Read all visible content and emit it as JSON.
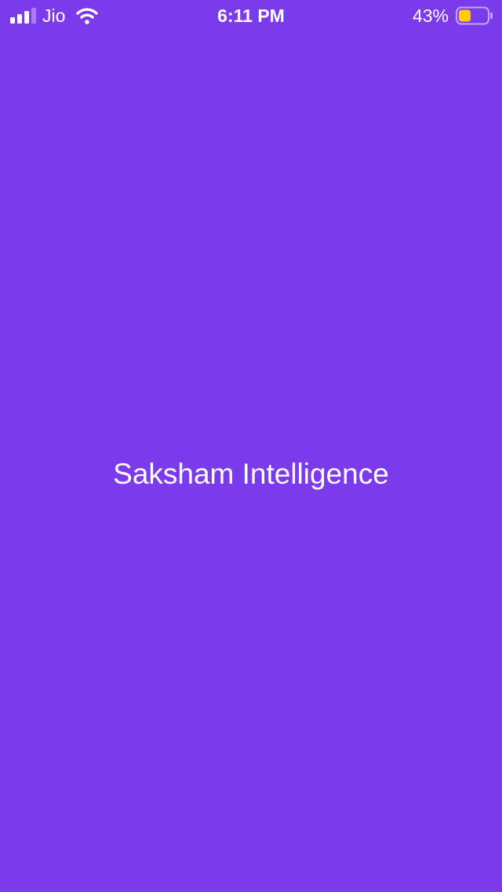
{
  "status_bar": {
    "carrier": "Jio",
    "time": "6:11 PM",
    "battery_percent": "43%",
    "battery_level": 0.43,
    "battery_color": "#ffcc00",
    "signal_bars_active": 3,
    "icons": [
      "signal-icon",
      "wifi-icon",
      "battery-icon"
    ]
  },
  "splash": {
    "title": "Saksham Intelligence",
    "background_color": "#7b3aeb",
    "text_color": "#ffffff"
  }
}
